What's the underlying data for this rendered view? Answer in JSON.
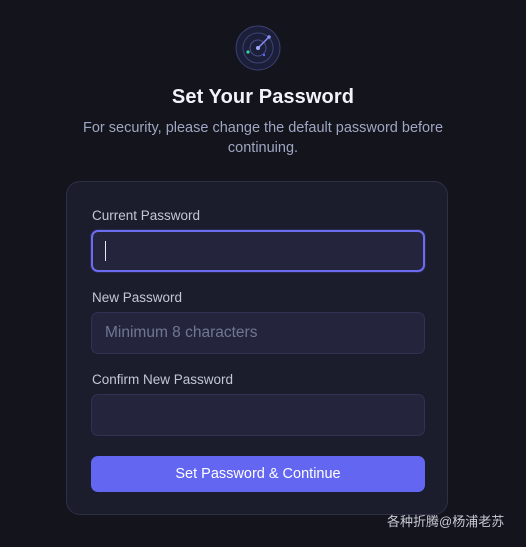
{
  "header": {
    "logo_icon": "radar-icon",
    "title": "Set Your Password",
    "subtitle": "For security, please change the default password before continuing."
  },
  "form": {
    "current_password": {
      "label": "Current Password",
      "value": "",
      "placeholder": "",
      "focused": true
    },
    "new_password": {
      "label": "New Password",
      "value": "",
      "placeholder": "Minimum 8 characters"
    },
    "confirm_password": {
      "label": "Confirm New Password",
      "value": "",
      "placeholder": ""
    },
    "submit_label": "Set Password & Continue"
  },
  "watermark": "各种折腾@杨浦老苏",
  "colors": {
    "background": "#13141c",
    "card": "#1b1d2c",
    "input": "#24253c",
    "accent": "#6366f1",
    "focus_border": "#6c6cf0"
  }
}
